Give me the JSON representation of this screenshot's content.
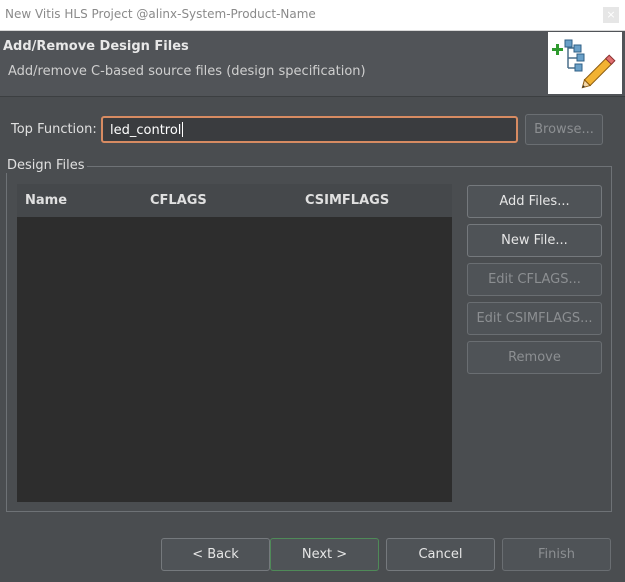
{
  "window": {
    "title": "New Vitis HLS Project @alinx-System-Product-Name",
    "close_label": "×"
  },
  "header": {
    "title": "Add/Remove Design Files",
    "subtitle": "Add/remove C-based source files (design specification)",
    "icon": "wizard-tree-pencil-icon"
  },
  "top_function": {
    "label": "Top Function:",
    "value": "led_control",
    "browse_label": "Browse..."
  },
  "design_files": {
    "group_label": "Design Files",
    "columns": [
      "Name",
      "CFLAGS",
      "CSIMFLAGS"
    ],
    "rows": [],
    "buttons": {
      "add_files": "Add Files...",
      "new_file": "New File...",
      "edit_cflags": "Edit CFLAGS...",
      "edit_csimflags": "Edit CSIMFLAGS...",
      "remove": "Remove"
    }
  },
  "footer": {
    "back": "< Back",
    "next": "Next >",
    "cancel": "Cancel",
    "finish": "Finish"
  },
  "colors": {
    "background": "#4a4d50",
    "focus_border": "#d78b62",
    "table_bg": "#2d2d2d",
    "primary_border": "#4f8a58"
  }
}
